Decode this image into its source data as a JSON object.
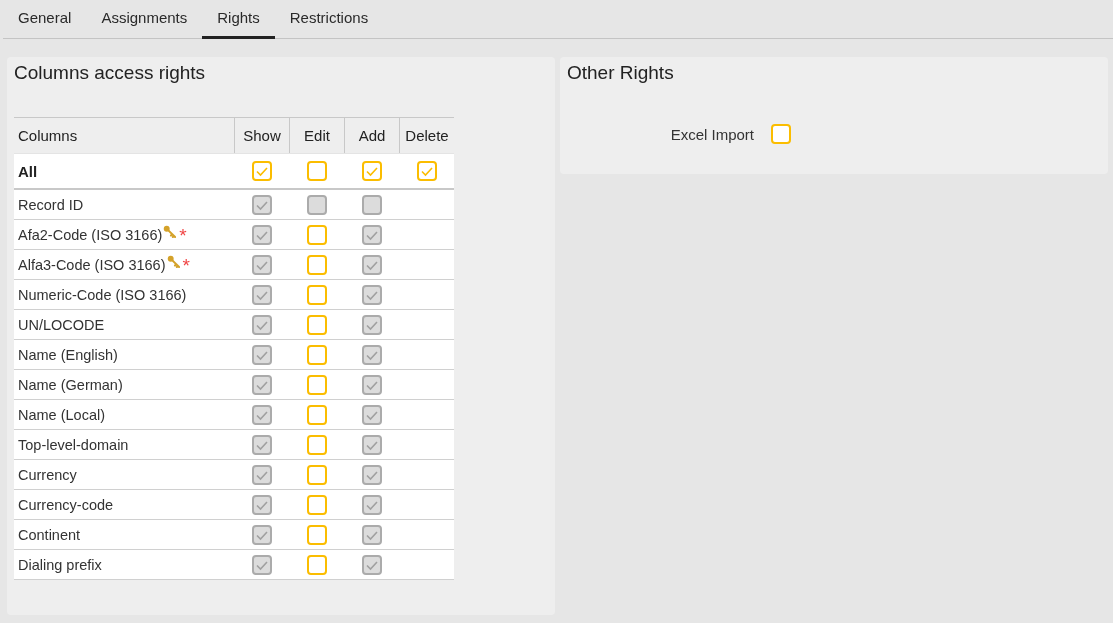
{
  "tabs": [
    {
      "label": "General",
      "selected": false
    },
    {
      "label": "Assignments",
      "selected": false
    },
    {
      "label": "Rights",
      "selected": true
    },
    {
      "label": "Restrictions",
      "selected": false
    }
  ],
  "columns_access": {
    "title": "Columns access rights",
    "columns": [
      "Columns",
      "Show",
      "Edit",
      "Add",
      "Delete"
    ],
    "all_row": {
      "label": "All",
      "cells": [
        {
          "checked": true,
          "disabled": false
        },
        {
          "checked": false,
          "disabled": false
        },
        {
          "checked": true,
          "disabled": false
        },
        {
          "checked": true,
          "disabled": false
        }
      ]
    },
    "rows": [
      {
        "label": "Record ID",
        "key": false,
        "cells": [
          {
            "checked": true,
            "disabled": true
          },
          {
            "checked": false,
            "disabled": true
          },
          {
            "checked": false,
            "disabled": true
          }
        ]
      },
      {
        "label": "Afa2-Code (ISO 3166)",
        "key": true,
        "required_mark": "*",
        "cells": [
          {
            "checked": true,
            "disabled": true
          },
          {
            "checked": false,
            "disabled": false
          },
          {
            "checked": true,
            "disabled": true
          }
        ]
      },
      {
        "label": "Alfa3-Code (ISO 3166)",
        "key": true,
        "required_mark": "*",
        "cells": [
          {
            "checked": true,
            "disabled": true
          },
          {
            "checked": false,
            "disabled": false
          },
          {
            "checked": true,
            "disabled": true
          }
        ]
      },
      {
        "label": "Numeric-Code (ISO 3166)",
        "key": false,
        "cells": [
          {
            "checked": true,
            "disabled": true
          },
          {
            "checked": false,
            "disabled": false
          },
          {
            "checked": true,
            "disabled": true
          }
        ]
      },
      {
        "label": "UN/LOCODE",
        "key": false,
        "cells": [
          {
            "checked": true,
            "disabled": true
          },
          {
            "checked": false,
            "disabled": false
          },
          {
            "checked": true,
            "disabled": true
          }
        ]
      },
      {
        "label": "Name (English)",
        "key": false,
        "cells": [
          {
            "checked": true,
            "disabled": true
          },
          {
            "checked": false,
            "disabled": false
          },
          {
            "checked": true,
            "disabled": true
          }
        ]
      },
      {
        "label": "Name (German)",
        "key": false,
        "cells": [
          {
            "checked": true,
            "disabled": true
          },
          {
            "checked": false,
            "disabled": false
          },
          {
            "checked": true,
            "disabled": true
          }
        ]
      },
      {
        "label": "Name (Local)",
        "key": false,
        "cells": [
          {
            "checked": true,
            "disabled": true
          },
          {
            "checked": false,
            "disabled": false
          },
          {
            "checked": true,
            "disabled": true
          }
        ]
      },
      {
        "label": "Top-level-domain",
        "key": false,
        "cells": [
          {
            "checked": true,
            "disabled": true
          },
          {
            "checked": false,
            "disabled": false
          },
          {
            "checked": true,
            "disabled": true
          }
        ]
      },
      {
        "label": "Currency",
        "key": false,
        "cells": [
          {
            "checked": true,
            "disabled": true
          },
          {
            "checked": false,
            "disabled": false
          },
          {
            "checked": true,
            "disabled": true
          }
        ]
      },
      {
        "label": "Currency-code",
        "key": false,
        "cells": [
          {
            "checked": true,
            "disabled": true
          },
          {
            "checked": false,
            "disabled": false
          },
          {
            "checked": true,
            "disabled": true
          }
        ]
      },
      {
        "label": "Continent",
        "key": false,
        "cells": [
          {
            "checked": true,
            "disabled": true
          },
          {
            "checked": false,
            "disabled": false
          },
          {
            "checked": true,
            "disabled": true
          }
        ]
      },
      {
        "label": "Dialing prefix",
        "key": false,
        "cells": [
          {
            "checked": true,
            "disabled": true
          },
          {
            "checked": false,
            "disabled": false
          },
          {
            "checked": true,
            "disabled": true
          }
        ]
      }
    ]
  },
  "other_rights": {
    "title": "Other Rights",
    "items": [
      {
        "label": "Excel Import",
        "checked": false,
        "disabled": false
      }
    ]
  }
}
